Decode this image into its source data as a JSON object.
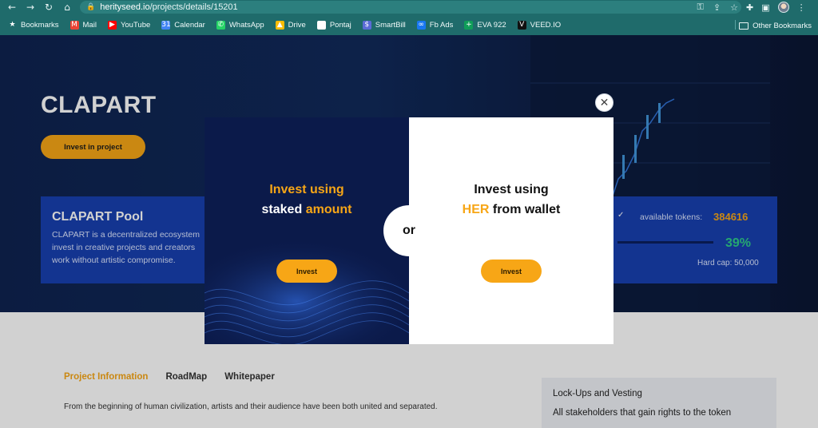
{
  "browser": {
    "url_host": "herityseed.io",
    "url_path": "/projects/details/15201",
    "bookmarks": [
      {
        "label": "Bookmarks",
        "icon": "star-icon",
        "color": "#ffffff"
      },
      {
        "label": "Mail",
        "icon": "gmail-icon",
        "color": "#ea4335"
      },
      {
        "label": "YouTube",
        "icon": "youtube-icon",
        "color": "#ff0000"
      },
      {
        "label": "Calendar",
        "icon": "calendar-icon",
        "color": "#4285f4"
      },
      {
        "label": "WhatsApp",
        "icon": "whatsapp-icon",
        "color": "#25d366"
      },
      {
        "label": "Drive",
        "icon": "drive-icon",
        "color": "#fbbc04"
      },
      {
        "label": "Pontaj",
        "icon": "globe-icon",
        "color": "#ffffff"
      },
      {
        "label": "SmartBill",
        "icon": "smartbill-icon",
        "color": "#5b6bd6"
      },
      {
        "label": "Fb Ads",
        "icon": "meta-icon",
        "color": "#1877f2"
      },
      {
        "label": "EVA 922",
        "icon": "sheets-icon",
        "color": "#0f9d58"
      },
      {
        "label": "VEED.IO",
        "icon": "veed-icon",
        "color": "#111111"
      }
    ],
    "other_bookmarks": "Other Bookmarks"
  },
  "hero": {
    "project_title": "CLAPART",
    "invest_button": "Invest in project"
  },
  "pool": {
    "title": "CLAPART Pool",
    "description": "CLAPART is a decentralized ecosystem invest in creative projects and creators work without artistic compromise.",
    "tokens_label": "available tokens:",
    "tokens_value": "384616",
    "progress_percent": "39%",
    "progress_fraction": 0.39,
    "hard_cap": "Hard cap: 50,000"
  },
  "content": {
    "tabs": [
      {
        "label": "Project Information",
        "active": true
      },
      {
        "label": "RoadMap",
        "active": false
      },
      {
        "label": "Whitepaper",
        "active": false
      }
    ],
    "intro_text": "From the beginning of human civilization, artists and their audience have been both united and separated.",
    "side_title": "Lock-Ups and Vesting",
    "side_text": "All stakeholders that gain rights to the token"
  },
  "modal": {
    "left": {
      "line1": "Invest using",
      "line2_a": "staked",
      "line2_b": "amount",
      "button": "Invest"
    },
    "or_label": "or",
    "right": {
      "line1": "Invest using",
      "line2_a": "HER",
      "line2_b": "from wallet",
      "button": "Invest"
    }
  },
  "colors": {
    "accent": "#f7a616",
    "chrome": "#1f6b6b",
    "pool_bg": "#1840b0",
    "success": "#2ecc8a"
  }
}
